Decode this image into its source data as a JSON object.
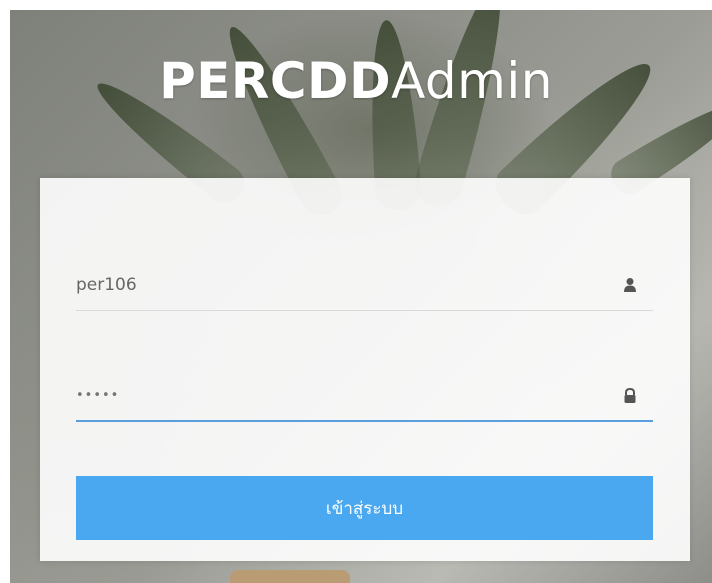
{
  "brand": {
    "bold_part": "PERCDD",
    "light_part": "Admin"
  },
  "form": {
    "username_value": "per106",
    "password_value": "•••••",
    "login_label": "เข้าสู่ระบบ"
  },
  "icons": {
    "user": "user-icon",
    "password": "lock-icon"
  },
  "colors": {
    "button": "#4aa8f0",
    "active_underline": "#5b9ee0"
  }
}
